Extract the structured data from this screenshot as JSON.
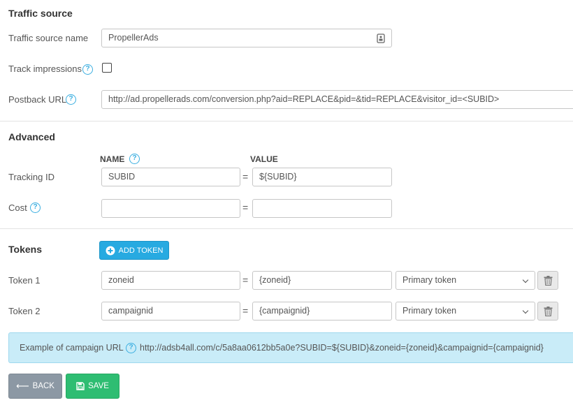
{
  "traffic_source": {
    "title": "Traffic source",
    "name_label": "Traffic source name",
    "name_value": "PropellerAds",
    "track_impressions_label": "Track impressions",
    "track_impressions_checked": false,
    "postback_label": "Postback URL",
    "postback_value": "http://ad.propellerads.com/conversion.php?aid=REPLACE&pid=&tid=REPLACE&visitor_id=<SUBID>"
  },
  "advanced": {
    "title": "Advanced",
    "name_header": "NAME",
    "value_header": "VALUE",
    "tracking_id": {
      "label": "Tracking ID",
      "name": "SUBID",
      "value": "${SUBID}"
    },
    "cost": {
      "label": "Cost",
      "name": "",
      "value": ""
    }
  },
  "tokens": {
    "title": "Tokens",
    "add_label": "ADD TOKEN",
    "rows": [
      {
        "label": "Token 1",
        "name": "zoneid",
        "value": "{zoneid}",
        "type": "Primary token"
      },
      {
        "label": "Token 2",
        "name": "campaignid",
        "value": "{campaignid}",
        "type": "Primary token"
      }
    ]
  },
  "example": {
    "label": "Example of campaign URL",
    "url": "http://adsb4all.com/c/5a8aa0612bb5a0e?SUBID=${SUBID}&zoneid={zoneid}&campaignid={campaignid}"
  },
  "actions": {
    "back_label": "BACK",
    "save_label": "SAVE"
  },
  "colors": {
    "accent_blue": "#27aae1",
    "save_green": "#2ebd72",
    "back_gray": "#8c98a4",
    "example_bg": "#c9ecf8"
  },
  "icons": {
    "help": "question-circle-icon",
    "field_badge": "id-card-icon",
    "add": "plus-circle-icon",
    "delete": "trash-icon",
    "back": "arrow-left-icon",
    "save": "floppy-disk-icon",
    "select": "chevron-down-icon"
  }
}
